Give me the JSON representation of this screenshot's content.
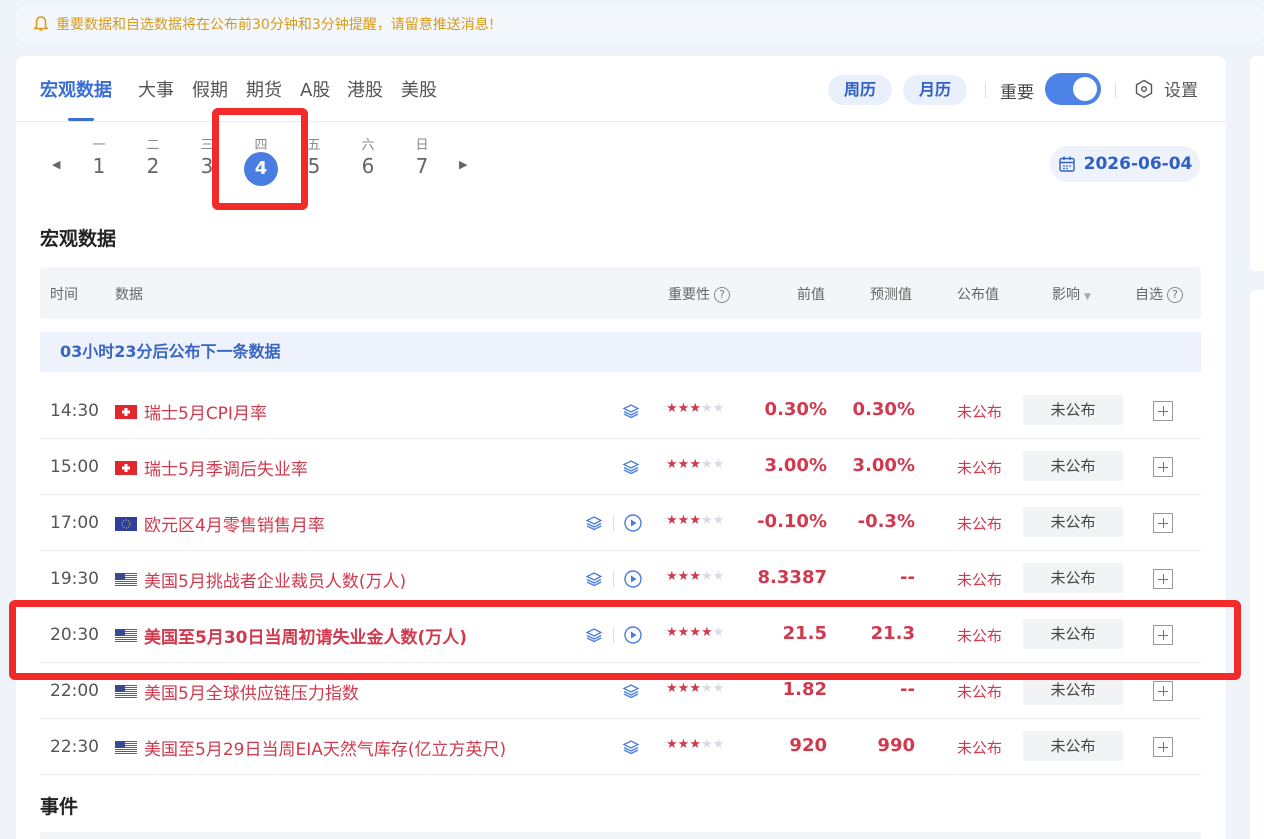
{
  "notice": {
    "text": "重要数据和自选数据将在公布前30分钟和3分钟提醒，请留意推送消息!"
  },
  "tabs": [
    {
      "label": "宏观数据"
    },
    {
      "label": "大事"
    },
    {
      "label": "假期"
    },
    {
      "label": "期货"
    },
    {
      "label": "A股"
    },
    {
      "label": "港股"
    },
    {
      "label": "美股"
    }
  ],
  "view": {
    "week_label": "周历",
    "month_label": "月历"
  },
  "important": {
    "label": "重要",
    "enabled": true
  },
  "settings": {
    "label": "设置"
  },
  "week": {
    "days": [
      {
        "wk": "一",
        "num": "1"
      },
      {
        "wk": "二",
        "num": "2"
      },
      {
        "wk": "三",
        "num": "3"
      },
      {
        "wk": "四",
        "num": "4"
      },
      {
        "wk": "五",
        "num": "5"
      },
      {
        "wk": "六",
        "num": "6"
      },
      {
        "wk": "日",
        "num": "7"
      }
    ],
    "selected_index": 3
  },
  "date": {
    "value": "2026-06-04"
  },
  "macro": {
    "section_title": "宏观数据",
    "headers": {
      "time": "时间",
      "data": "数据",
      "importance": "重要性",
      "previous": "前值",
      "forecast": "预测值",
      "actual": "公布值",
      "impact": "影响",
      "watch": "自选"
    },
    "next_notice": "03小时23分后公布下一条数据",
    "rows": [
      {
        "time": "14:30",
        "flag": "CH",
        "title": "瑞士5月CPI月率",
        "stars": 3,
        "previous": "0.30%",
        "forecast": "0.30%",
        "actual": "未公布",
        "impact": "未公布",
        "has_play": false,
        "bold": false
      },
      {
        "time": "15:00",
        "flag": "CH",
        "title": "瑞士5月季调后失业率",
        "stars": 3,
        "previous": "3.00%",
        "forecast": "3.00%",
        "actual": "未公布",
        "impact": "未公布",
        "has_play": false,
        "bold": false
      },
      {
        "time": "17:00",
        "flag": "EU",
        "title": "欧元区4月零售销售月率",
        "stars": 3,
        "previous": "-0.10%",
        "forecast": "-0.3%",
        "actual": "未公布",
        "impact": "未公布",
        "has_play": true,
        "bold": false
      },
      {
        "time": "19:30",
        "flag": "US",
        "title": "美国5月挑战者企业裁员人数(万人)",
        "stars": 3,
        "previous": "8.3387",
        "forecast": "--",
        "actual": "未公布",
        "impact": "未公布",
        "has_play": true,
        "bold": false
      },
      {
        "time": "20:30",
        "flag": "US",
        "title": "美国至5月30日当周初请失业金人数(万人)",
        "stars": 4,
        "previous": "21.5",
        "forecast": "21.3",
        "actual": "未公布",
        "impact": "未公布",
        "has_play": true,
        "bold": true
      },
      {
        "time": "22:00",
        "flag": "US",
        "title": "美国5月全球供应链压力指数",
        "stars": 3,
        "previous": "1.82",
        "forecast": "--",
        "actual": "未公布",
        "impact": "未公布",
        "has_play": false,
        "bold": false
      },
      {
        "time": "22:30",
        "flag": "US",
        "title": "美国至5月29日当周EIA天然气库存(亿立方英尺)",
        "stars": 3,
        "previous": "920",
        "forecast": "990",
        "actual": "未公布",
        "impact": "未公布",
        "has_play": false,
        "bold": false
      }
    ]
  },
  "events": {
    "section_title": "事件"
  },
  "colors": {
    "accent": "#3b6fd6",
    "value_red": "#d03a4e",
    "highlight_box": "#f22a2a",
    "notice": "#d79a1a"
  }
}
